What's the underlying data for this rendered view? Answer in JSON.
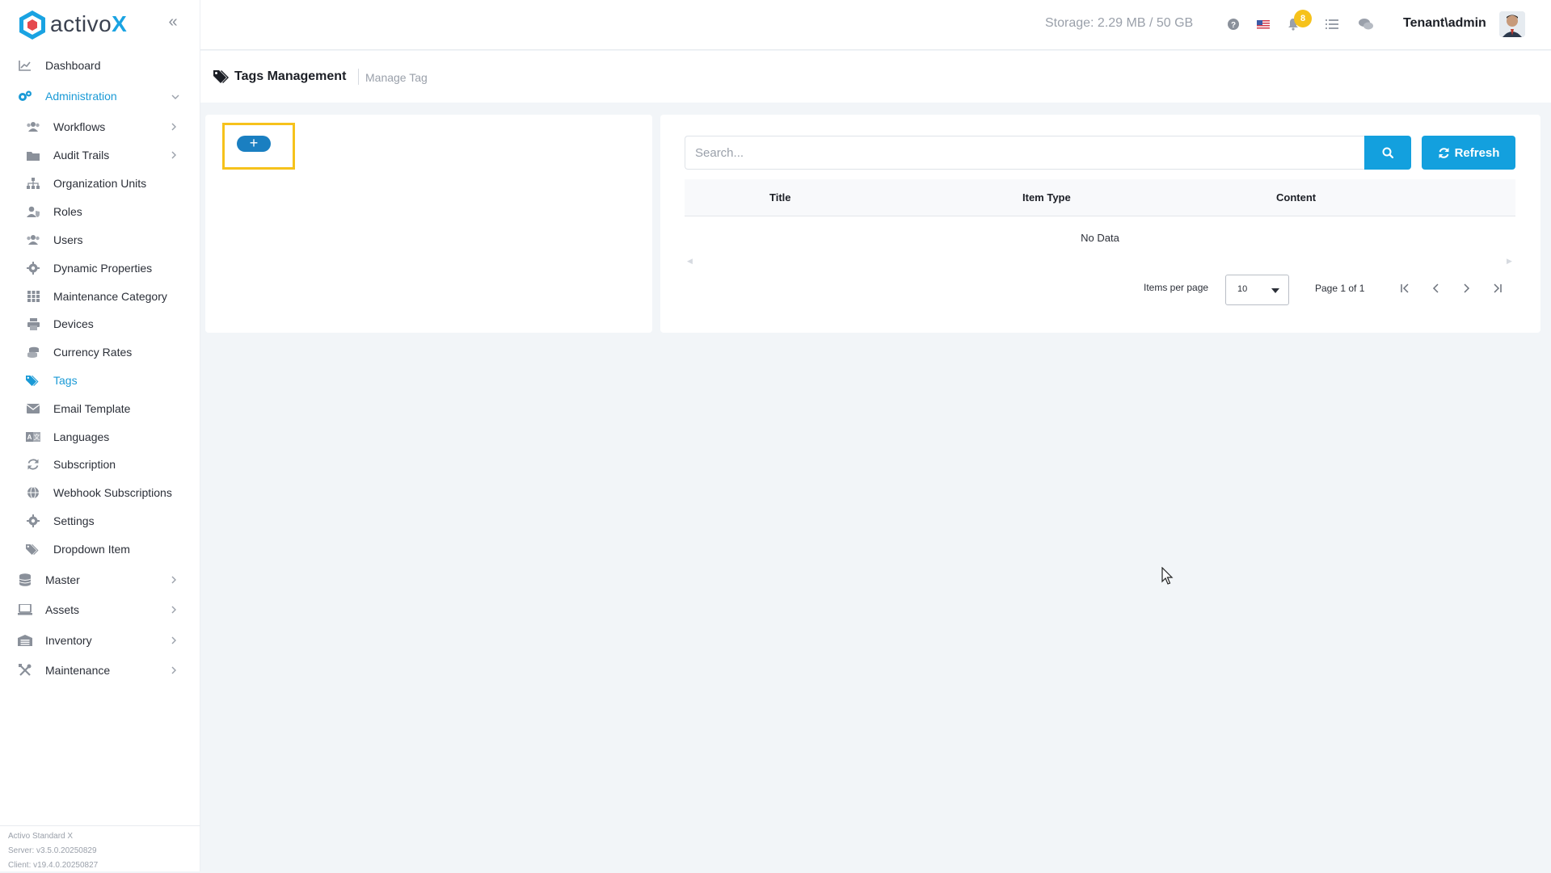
{
  "app": {
    "logo_text_main": "activo",
    "logo_text_accent": "X",
    "brand_color": "#1aa3e2"
  },
  "sidebar": {
    "items": [
      {
        "label": "Dashboard",
        "icon": "chart-line-icon",
        "level": 0
      },
      {
        "label": "Administration",
        "icon": "cogs-icon",
        "level": 0,
        "active": true,
        "expanded": true
      },
      {
        "label": "Workflows",
        "icon": "users-icon",
        "level": 1,
        "has_children": true
      },
      {
        "label": "Audit Trails",
        "icon": "folder-icon",
        "level": 1,
        "has_children": true
      },
      {
        "label": "Organization Units",
        "icon": "sitemap-icon",
        "level": 1
      },
      {
        "label": "Roles",
        "icon": "user-shield-icon",
        "level": 1
      },
      {
        "label": "Users",
        "icon": "users-icon",
        "level": 1
      },
      {
        "label": "Dynamic Properties",
        "icon": "gear-icon",
        "level": 1
      },
      {
        "label": "Maintenance Category",
        "icon": "grid-icon",
        "level": 1
      },
      {
        "label": "Devices",
        "icon": "printer-icon",
        "level": 1
      },
      {
        "label": "Currency Rates",
        "icon": "coins-icon",
        "level": 1
      },
      {
        "label": "Tags",
        "icon": "tags-icon",
        "level": 1,
        "active": true
      },
      {
        "label": "Email Template",
        "icon": "envelope-icon",
        "level": 1
      },
      {
        "label": "Languages",
        "icon": "language-icon",
        "level": 1
      },
      {
        "label": "Subscription",
        "icon": "sync-icon",
        "level": 1
      },
      {
        "label": "Webhook Subscriptions",
        "icon": "globe-icon",
        "level": 1
      },
      {
        "label": "Settings",
        "icon": "gear-icon",
        "level": 1
      },
      {
        "label": "Dropdown Item",
        "icon": "tags-icon",
        "level": 1
      },
      {
        "label": "Master",
        "icon": "database-icon",
        "level": 0,
        "has_children": true
      },
      {
        "label": "Assets",
        "icon": "laptop-icon",
        "level": 0,
        "has_children": true
      },
      {
        "label": "Inventory",
        "icon": "warehouse-icon",
        "level": 0,
        "has_children": true
      },
      {
        "label": "Maintenance",
        "icon": "tools-icon",
        "level": 0,
        "has_children": true
      }
    ],
    "footer": {
      "product": "Activo Standard X",
      "server": "Server: v3.5.0.20250829",
      "client": "Client: v19.4.0.20250827"
    }
  },
  "topbar": {
    "storage": "Storage: 2.29 MB / 50 GB",
    "notification_count": "8",
    "user": "Tenant\\admin"
  },
  "page": {
    "title": "Tags Management",
    "breadcrumb": "Manage Tag"
  },
  "left_panel": {
    "add_label": "+"
  },
  "right_panel": {
    "search_placeholder": "Search...",
    "refresh_label": "Refresh",
    "columns": [
      "Title",
      "Item Type",
      "Content"
    ],
    "empty_text": "No Data",
    "items_per_page_label": "Items per page",
    "items_per_page_value": "10",
    "page_info": "Page 1 of 1"
  },
  "colors": {
    "accent": "#13a0de",
    "highlight": "#f6c21b",
    "badge": "#f6c21b"
  }
}
